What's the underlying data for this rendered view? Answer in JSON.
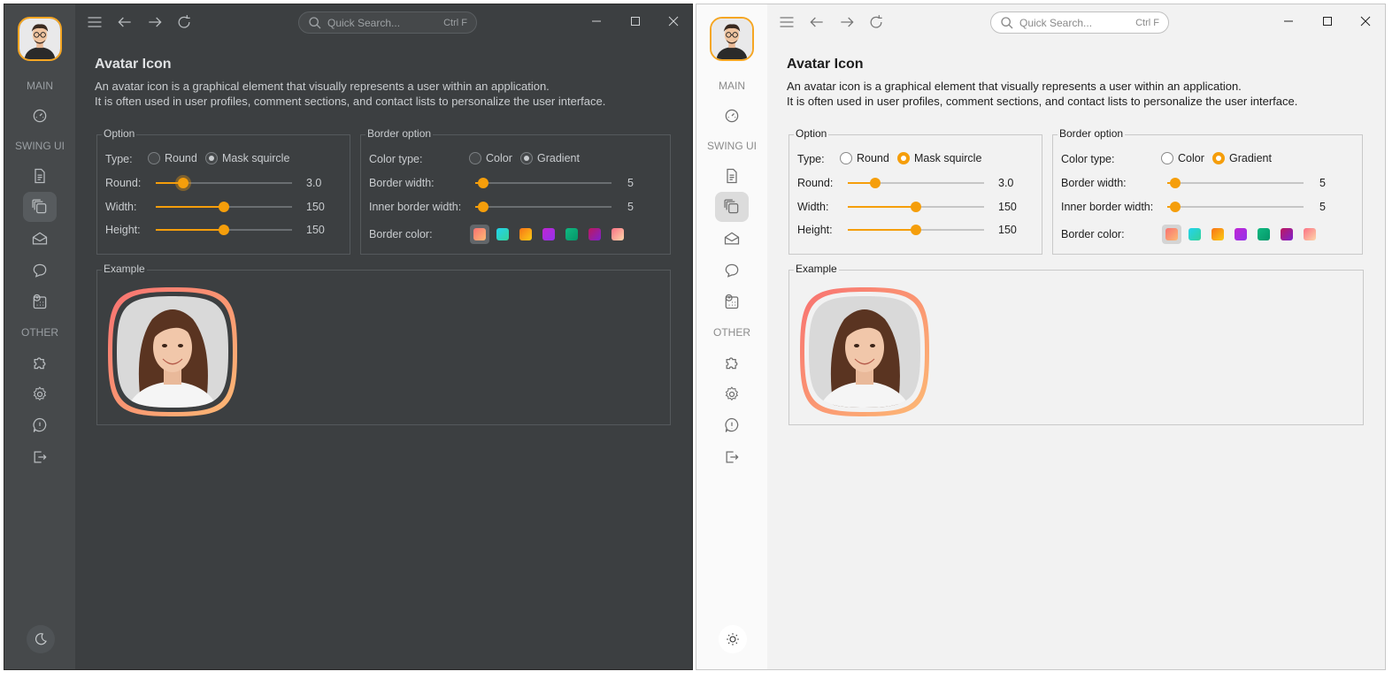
{
  "search": {
    "placeholder": "Quick Search...",
    "shortcut": "Ctrl F"
  },
  "sidebar": {
    "sections": {
      "main": "MAIN",
      "swing": "SWING UI",
      "other": "OTHER"
    },
    "icons": [
      "dashboard-icon",
      "document-icon",
      "layers-icon",
      "mail-icon",
      "chat-icon",
      "calendar-icon",
      "puzzle-icon",
      "gear-icon",
      "alert-icon",
      "logout-icon"
    ]
  },
  "page": {
    "title": "Avatar Icon",
    "desc1": "An avatar icon is a graphical element that visually represents a user within an application.",
    "desc2": "It is often used in user profiles, comment sections, and contact lists to personalize the user interface."
  },
  "option": {
    "title": "Option",
    "type_label": "Type:",
    "type_round": "Round",
    "type_mask": "Mask squircle",
    "round_label": "Round:",
    "round_value": "3.0",
    "round_fraction": 0.2,
    "width_label": "Width:",
    "width_value": "150",
    "width_fraction": 0.5,
    "height_label": "Height:",
    "height_value": "150",
    "height_fraction": 0.5
  },
  "border": {
    "title": "Border option",
    "color_type_label": "Color type:",
    "color_option": "Color",
    "gradient_option": "Gradient",
    "width_label": "Border width:",
    "width_value": "5",
    "width_fraction": 0.06,
    "inner_label": "Inner border width:",
    "inner_value": "5",
    "inner_fraction": 0.06,
    "color_label": "Border color:",
    "swatches": [
      [
        "#f87171",
        "#fdba74"
      ],
      [
        "#22d3ee",
        "#34d399"
      ],
      [
        "#f97316",
        "#facc15"
      ],
      [
        "#c026d3",
        "#9333ea"
      ],
      [
        "#10b981",
        "#059669"
      ],
      [
        "#be185d",
        "#7e22ce"
      ],
      [
        "#fb7185",
        "#fed7aa"
      ]
    ]
  },
  "example": {
    "title": "Example"
  },
  "colors": {
    "accent": "#f59e0b"
  }
}
